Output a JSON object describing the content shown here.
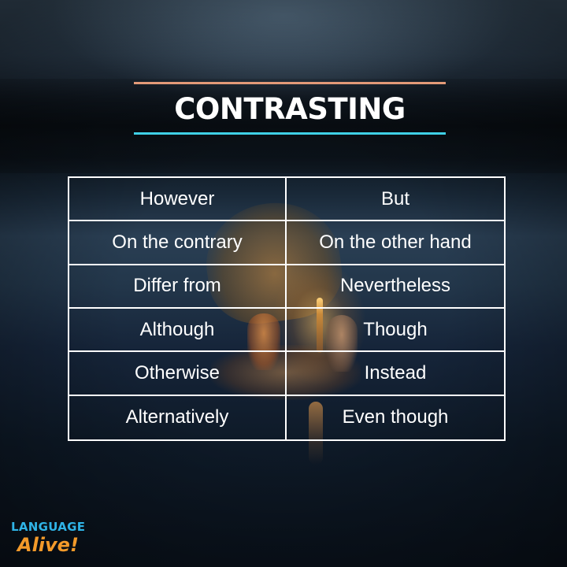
{
  "title": "CONTRASTING",
  "colors": {
    "rule_top": "#e39a78",
    "rule_bottom": "#3fd0e6",
    "text": "#ffffff",
    "logo_blue": "#2fb3e6",
    "logo_orange": "#f39a2a"
  },
  "table": {
    "rows": [
      {
        "left": "However",
        "right": "But"
      },
      {
        "left": "On the contrary",
        "right": "On the other hand"
      },
      {
        "left": "Differ from",
        "right": "Nevertheless"
      },
      {
        "left": "Although",
        "right": "Though"
      },
      {
        "left": "Otherwise",
        "right": "Instead"
      },
      {
        "left": "Alternatively",
        "right": "Even though"
      }
    ]
  },
  "logo": {
    "line1": "LANGUAGE",
    "line2": "Alive!"
  }
}
